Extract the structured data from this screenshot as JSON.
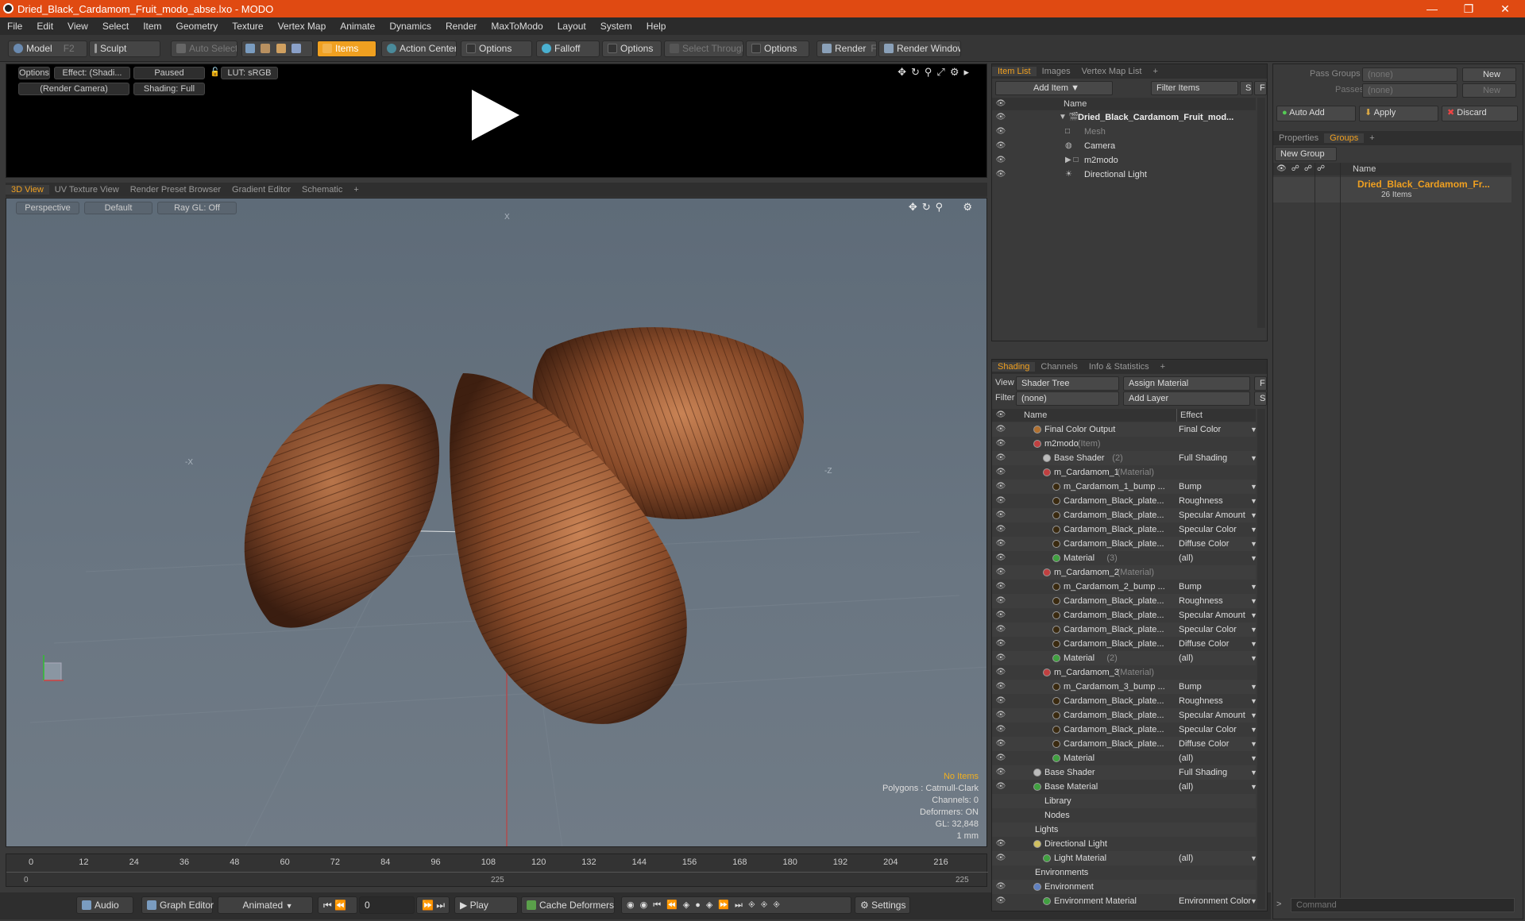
{
  "window": {
    "title": "Dried_Black_Cardamom_Fruit_modo_abse.lxo - MODO"
  },
  "menu": [
    "File",
    "Edit",
    "View",
    "Select",
    "Item",
    "Geometry",
    "Texture",
    "Vertex Map",
    "Animate",
    "Dynamics",
    "Render",
    "MaxToModo",
    "Layout",
    "System",
    "Help"
  ],
  "toolbar": {
    "model": "Model",
    "model_key": "F2",
    "sculpt": "Sculpt",
    "auto_select": "Auto Select",
    "items": "Items",
    "action_center": "Action Center",
    "options1": "Options",
    "falloff": "Falloff",
    "options2": "Options",
    "select_through": "Select Through",
    "options3": "Options",
    "render": "Render",
    "render_key": "F9",
    "render_window": "Render Window"
  },
  "preview": {
    "options": "Options",
    "effect": "Effect: (Shadi...",
    "paused": "Paused",
    "lut": "LUT: sRGB",
    "camera": "(Render Camera)",
    "shading": "Shading: Full"
  },
  "viewport_tabs": [
    "3D View",
    "UV Texture View",
    "Render Preset Browser",
    "Gradient Editor",
    "Schematic"
  ],
  "viewport": {
    "perspective": "Perspective",
    "default": "Default",
    "raygl": "Ray GL: Off",
    "info": {
      "no_items": "No Items",
      "polygons": "Polygons : Catmull-Clark",
      "channels": "Channels: 0",
      "deformers": "Deformers: ON",
      "gl": "GL: 32,848",
      "scale": "1 mm"
    },
    "axis_labels": {
      "x_neg": "-X",
      "z_neg": "-Z",
      "x_top": "X"
    }
  },
  "timeline": {
    "ticks": [
      "0",
      "12",
      "24",
      "36",
      "48",
      "60",
      "72",
      "84",
      "96",
      "108",
      "120",
      "132",
      "144",
      "156",
      "168",
      "180",
      "192",
      "204",
      "216"
    ],
    "start": "0",
    "mid": "225",
    "end": "225"
  },
  "bottombar": {
    "audio": "Audio",
    "graph_editor": "Graph Editor",
    "animated": "Animated",
    "frame": "0",
    "play": "Play",
    "cache_deformers": "Cache Deformers",
    "settings": "Settings"
  },
  "item_list": {
    "tabs": [
      "Item List",
      "Images",
      "Vertex Map List"
    ],
    "add_item": "Add Item",
    "filter_items": "Filter Items",
    "s": "S",
    "f": "F",
    "name_header": "Name",
    "items": [
      {
        "label": "Dried_Black_Cardamom_Fruit_mod...",
        "style": "bold"
      },
      {
        "label": "Mesh",
        "style": "grey"
      },
      {
        "label": "Camera",
        "style": "normal"
      },
      {
        "label": "m2modo",
        "style": "normal"
      },
      {
        "label": "Directional Light",
        "style": "normal"
      }
    ]
  },
  "shading": {
    "tabs": [
      "Shading",
      "Channels",
      "Info & Statistics"
    ],
    "view_label": "View",
    "view_value": "Shader Tree",
    "assign_material": "Assign Material",
    "filter_label": "Filter",
    "filter_value": "(none)",
    "add_layer": "Add Layer",
    "f": "F",
    "s": "S",
    "name_header": "Name",
    "effect_header": "Effect",
    "rows": [
      {
        "label": "Final Color Output",
        "effect": "Final Color",
        "indent": 1
      },
      {
        "label": "m2modo",
        "suffix": "(Item)",
        "effect": "",
        "indent": 1
      },
      {
        "label": "Base Shader",
        "suffix": "(2)",
        "effect": "Full Shading",
        "indent": 2
      },
      {
        "label": "m_Cardamom_1",
        "suffix": "(Material)",
        "effect": "",
        "indent": 2
      },
      {
        "label": "m_Cardamom_1_bump ...",
        "effect": "Bump",
        "indent": 3
      },
      {
        "label": "Cardamom_Black_plate...",
        "effect": "Roughness",
        "indent": 3
      },
      {
        "label": "Cardamom_Black_plate...",
        "effect": "Specular Amount",
        "indent": 3
      },
      {
        "label": "Cardamom_Black_plate...",
        "effect": "Specular Color",
        "indent": 3
      },
      {
        "label": "Cardamom_Black_plate...",
        "effect": "Diffuse Color",
        "indent": 3
      },
      {
        "label": "Material",
        "suffix": "(3)",
        "effect": "(all)",
        "indent": 3
      },
      {
        "label": "m_Cardamom_2",
        "suffix": "(Material)",
        "effect": "",
        "indent": 2
      },
      {
        "label": "m_Cardamom_2_bump ...",
        "effect": "Bump",
        "indent": 3
      },
      {
        "label": "Cardamom_Black_plate...",
        "effect": "Roughness",
        "indent": 3
      },
      {
        "label": "Cardamom_Black_plate...",
        "effect": "Specular Amount",
        "indent": 3
      },
      {
        "label": "Cardamom_Black_plate...",
        "effect": "Specular Color",
        "indent": 3
      },
      {
        "label": "Cardamom_Black_plate...",
        "effect": "Diffuse Color",
        "indent": 3
      },
      {
        "label": "Material",
        "suffix": "(2)",
        "effect": "(all)",
        "indent": 3
      },
      {
        "label": "m_Cardamom_3",
        "suffix": "(Material)",
        "effect": "",
        "indent": 2
      },
      {
        "label": "m_Cardamom_3_bump ...",
        "effect": "Bump",
        "indent": 3
      },
      {
        "label": "Cardamom_Black_plate...",
        "effect": "Roughness",
        "indent": 3
      },
      {
        "label": "Cardamom_Black_plate...",
        "effect": "Specular Amount",
        "indent": 3
      },
      {
        "label": "Cardamom_Black_plate...",
        "effect": "Specular Color",
        "indent": 3
      },
      {
        "label": "Cardamom_Black_plate...",
        "effect": "Diffuse Color",
        "indent": 3
      },
      {
        "label": "Material",
        "effect": "(all)",
        "indent": 3
      },
      {
        "label": "Base Shader",
        "effect": "Full Shading",
        "indent": 1
      },
      {
        "label": "Base Material",
        "effect": "(all)",
        "indent": 1
      },
      {
        "label": "Library",
        "effect": "",
        "indent": 1
      },
      {
        "label": "Nodes",
        "effect": "",
        "indent": 1
      },
      {
        "label": "Lights",
        "effect": "",
        "indent": 0
      },
      {
        "label": "Directional Light",
        "effect": "",
        "indent": 1
      },
      {
        "label": "Light Material",
        "effect": "(all)",
        "indent": 2
      },
      {
        "label": "Environments",
        "effect": "",
        "indent": 0
      },
      {
        "label": "Environment",
        "effect": "",
        "indent": 1
      },
      {
        "label": "Environment Material",
        "effect": "Environment Color",
        "indent": 2
      }
    ]
  },
  "groups": {
    "pass_groups_label": "Pass Groups",
    "pass_groups_value": "(none)",
    "new": "New",
    "passes_label": "Passes",
    "passes_value": "(none)",
    "new2": "New",
    "auto_add": "Auto Add",
    "apply": "Apply",
    "discard": "Discard",
    "tabs": [
      "Properties",
      "Groups"
    ],
    "new_group": "New Group",
    "name_header": "Name",
    "group_name": "Dried_Black_Cardamom_Fr...",
    "group_count": "26 Items",
    "command_placeholder": "Command"
  }
}
